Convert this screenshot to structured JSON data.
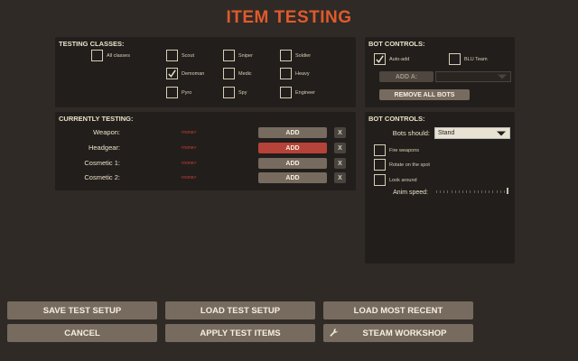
{
  "title": "ITEM TESTING",
  "testing_classes": {
    "title": "TESTING CLASSES:",
    "classes": [
      {
        "label": "All classes",
        "checked": false
      },
      {
        "label": "Scout",
        "checked": false
      },
      {
        "label": "Sniper",
        "checked": false
      },
      {
        "label": "Soldier",
        "checked": false
      },
      {
        "label": "Demoman",
        "checked": true
      },
      {
        "label": "Medic",
        "checked": false
      },
      {
        "label": "Heavy",
        "checked": false
      },
      {
        "label": "Pyro",
        "checked": false
      },
      {
        "label": "Spy",
        "checked": false
      },
      {
        "label": "Engineer",
        "checked": false
      }
    ]
  },
  "bot_controls_top": {
    "title": "BOT CONTROLS:",
    "auto_add_label": "Auto-add",
    "auto_add_checked": true,
    "blu_team_label": "BLU Team",
    "blu_team_checked": false,
    "add_a_label": "ADD A:",
    "add_a_value": "",
    "remove_all_label": "REMOVE ALL BOTS"
  },
  "currently_testing": {
    "title": "CURRENTLY TESTING:",
    "rows": [
      {
        "label": "Weapon:",
        "value": "<none>",
        "add_label": "ADD",
        "x_label": "X",
        "highlighted": false
      },
      {
        "label": "Headgear:",
        "value": "<none>",
        "add_label": "ADD",
        "x_label": "X",
        "highlighted": true
      },
      {
        "label": "Cosmetic 1:",
        "value": "<none>",
        "add_label": "ADD",
        "x_label": "X",
        "highlighted": false
      },
      {
        "label": "Cosmetic 2:",
        "value": "<none>",
        "add_label": "ADD",
        "x_label": "X",
        "highlighted": false
      }
    ]
  },
  "bot_controls_bottom": {
    "title": "BOT CONTROLS:",
    "bots_should_label": "Bots should:",
    "bots_should_value": "Stand",
    "fire_weapons_label": "Fire weapons",
    "rotate_label": "Rotate on the spot",
    "look_around_label": "Look around",
    "anim_speed_label": "Anim speed:",
    "anim_speed_fraction": 1.0
  },
  "footer": {
    "save_label": "SAVE TEST SETUP",
    "load_label": "LOAD TEST SETUP",
    "load_recent_label": "LOAD MOST RECENT",
    "cancel_label": "CANCEL",
    "apply_label": "APPLY TEST ITEMS",
    "workshop_label": "STEAM WORKSHOP"
  },
  "colors": {
    "accent": "#e05a2c",
    "panel": "#221e1b",
    "button": "#776b5f",
    "button_active": "#b5433a",
    "none_text": "#c8403a"
  }
}
